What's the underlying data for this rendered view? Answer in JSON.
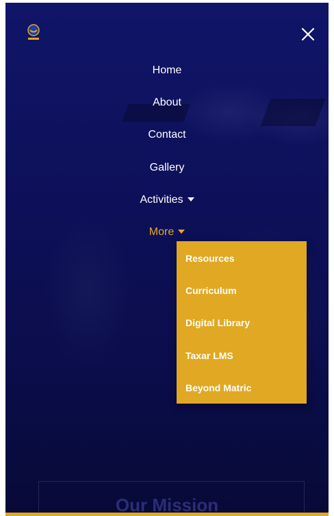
{
  "header": {
    "logo_icon": "graduate-logo-icon",
    "close_icon": "close-icon"
  },
  "nav": {
    "items": [
      {
        "label": "Home"
      },
      {
        "label": "About"
      },
      {
        "label": "Contact"
      },
      {
        "label": "Gallery"
      },
      {
        "label": "Activities",
        "has_dropdown": true
      },
      {
        "label": "More",
        "has_dropdown": true,
        "expanded": true
      }
    ]
  },
  "dropdown": {
    "items": [
      {
        "label": "Resources"
      },
      {
        "label": "Curriculum"
      },
      {
        "label": "Digital Library"
      },
      {
        "label": "Taxar LMS"
      },
      {
        "label": "Beyond Matric"
      }
    ]
  },
  "section": {
    "title": "Our Mission"
  },
  "colors": {
    "overlay": "#0a0c46",
    "accent": "#e0a823",
    "active_text": "#e3a82b",
    "text": "#ffffff"
  }
}
